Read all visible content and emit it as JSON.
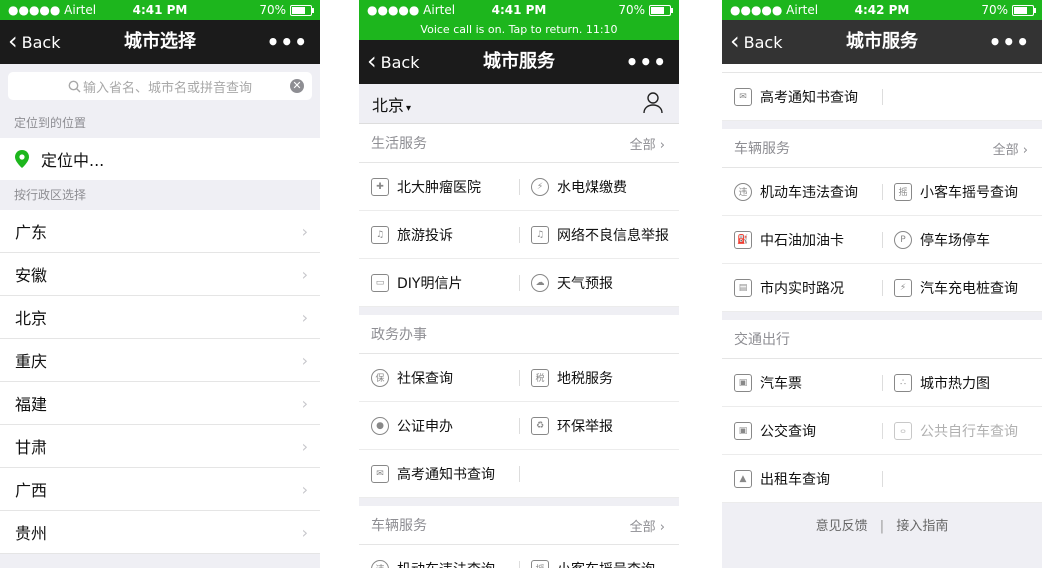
{
  "colors": {
    "accent": "#1db61d",
    "navbar": "#1b1b1b",
    "page_bg": "#efeff4"
  },
  "screen1": {
    "status": {
      "carrier": "●●●●● Airtel",
      "time": "4:41 PM",
      "battery": "70%"
    },
    "nav": {
      "back": "Back",
      "title": "城市选择",
      "more": "•••"
    },
    "search": {
      "placeholder": "输入省名、城市名或拼音查询"
    },
    "located_label": "定位到的位置",
    "location": "定位中...",
    "region_label": "按行政区选择",
    "provinces": [
      "广东",
      "安徽",
      "北京",
      "重庆",
      "福建",
      "甘肃",
      "广西",
      "贵州"
    ]
  },
  "screen2": {
    "status": {
      "carrier": "●●●●● Airtel",
      "time": "4:41 PM",
      "battery": "70%"
    },
    "callbar": "Voice call is on. Tap to return.  11:10",
    "nav": {
      "back": "Back",
      "title": "城市服务",
      "more": "•••"
    },
    "city": "北京",
    "sections": [
      {
        "title": "生活服务",
        "all": "全部",
        "items": [
          {
            "label": "北大肿瘤医院",
            "icon": "hospital-icon"
          },
          {
            "label": "水电煤缴费",
            "icon": "utility-icon"
          },
          {
            "label": "旅游投诉",
            "icon": "headset-icon"
          },
          {
            "label": "网络不良信息举报",
            "icon": "headset-icon"
          },
          {
            "label": "DIY明信片",
            "icon": "postcard-icon"
          },
          {
            "label": "天气预报",
            "icon": "weather-icon"
          }
        ]
      },
      {
        "title": "政务办事",
        "all": "",
        "items": [
          {
            "label": "社保查询",
            "icon": "social-security-icon"
          },
          {
            "label": "地税服务",
            "icon": "tax-icon"
          },
          {
            "label": "公证申办",
            "icon": "notary-icon"
          },
          {
            "label": "环保举报",
            "icon": "recycle-icon"
          },
          {
            "label": "高考通知书查询",
            "icon": "exam-notice-icon"
          },
          {
            "label": "",
            "icon": ""
          }
        ]
      },
      {
        "title": "车辆服务",
        "all": "全部",
        "items": [
          {
            "label": "机动车违法查询",
            "icon": "vehicle-violation-icon"
          },
          {
            "label": "小客车摇号查询",
            "icon": "car-lottery-icon"
          }
        ]
      }
    ]
  },
  "screen3": {
    "status": {
      "carrier": "●●●●● Airtel",
      "time": "4:42 PM",
      "battery": "70%"
    },
    "nav": {
      "back": "Back",
      "title": "城市服务",
      "more": "•••"
    },
    "top_items": [
      {
        "label": "高考通知书查询",
        "icon": "exam-notice-icon"
      },
      {
        "label": "",
        "icon": ""
      }
    ],
    "sections": [
      {
        "title": "车辆服务",
        "all": "全部",
        "items": [
          {
            "label": "机动车违法查询",
            "icon": "vehicle-violation-icon"
          },
          {
            "label": "小客车摇号查询",
            "icon": "car-lottery-icon"
          },
          {
            "label": "中石油加油卡",
            "icon": "fuel-card-icon"
          },
          {
            "label": "停车场停车",
            "icon": "parking-icon"
          },
          {
            "label": "市内实时路况",
            "icon": "traffic-icon"
          },
          {
            "label": "汽车充电桩查询",
            "icon": "charging-icon"
          }
        ]
      },
      {
        "title": "交通出行",
        "all": "",
        "items": [
          {
            "label": "汽车票",
            "icon": "bus-ticket-icon"
          },
          {
            "label": "城市热力图",
            "icon": "heatmap-icon"
          },
          {
            "label": "公交查询",
            "icon": "bus-icon"
          },
          {
            "label": "公共自行车查询",
            "icon": "bicycle-icon",
            "disabled": true
          },
          {
            "label": "出租车查询",
            "icon": "taxi-icon"
          },
          {
            "label": "",
            "icon": ""
          }
        ]
      }
    ],
    "footer": {
      "feedback": "意见反馈",
      "sep": "|",
      "guide": "接入指南"
    }
  }
}
